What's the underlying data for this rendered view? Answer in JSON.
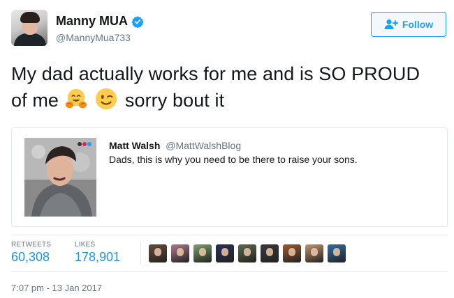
{
  "author": {
    "display_name": "Manny MUA",
    "handle": "@MannyMua733",
    "verified": true
  },
  "follow_button": {
    "label": "Follow",
    "icon": "follow-user-plus-icon"
  },
  "tweet": {
    "text_part1": "My dad actually works for me and is SO PROUD of me",
    "emojis": [
      "hugging-face-emoji",
      "winking-face-emoji"
    ],
    "text_part2": "sorry bout it"
  },
  "quoted_tweet": {
    "name": "Matt Walsh",
    "handle": "@MattWalshBlog",
    "text": "Dads, this is why you need to be there to raise your sons."
  },
  "stats": {
    "retweets_label": "RETWEETS",
    "retweets_value": "60,308",
    "likes_label": "LIKES",
    "likes_value": "178,901"
  },
  "likers": [
    {
      "name": "liker-avatar-1",
      "color": "#6b4a3a"
    },
    {
      "name": "liker-avatar-2",
      "color": "#b07a8c"
    },
    {
      "name": "liker-avatar-3",
      "color": "#7fa36b"
    },
    {
      "name": "liker-avatar-4",
      "color": "#2b2e57"
    },
    {
      "name": "liker-avatar-5",
      "color": "#5b6b4c"
    },
    {
      "name": "liker-avatar-6",
      "color": "#3a3a3a"
    },
    {
      "name": "liker-avatar-7",
      "color": "#a05a2c"
    },
    {
      "name": "liker-avatar-8",
      "color": "#c4956a"
    },
    {
      "name": "liker-avatar-9",
      "color": "#2f6fa8"
    }
  ],
  "timestamp": "7:07 pm - 13 Jan 2017",
  "colors": {
    "accent": "#1da1f2",
    "link_blue": "#1b95e0",
    "secondary_text": "#657786",
    "border": "#e1e8ed"
  }
}
